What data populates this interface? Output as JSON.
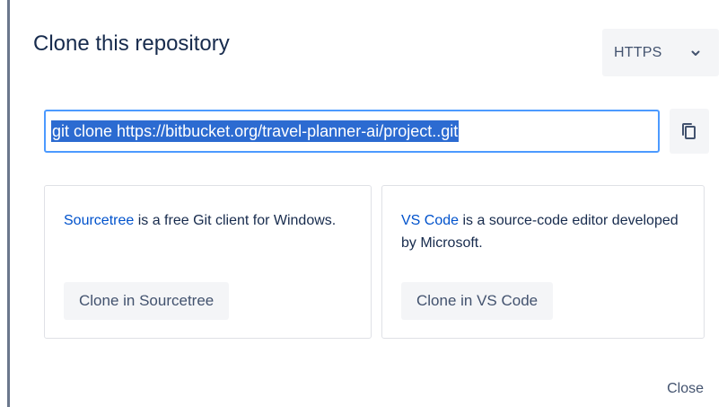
{
  "dialog": {
    "title": "Clone this repository",
    "protocol": {
      "selected": "HTTPS",
      "icon": "chevron-down-icon"
    },
    "clone_command": "git clone https://bitbucket.org/travel-planner-ai/project..git",
    "copy_icon": "copy-icon",
    "cards": [
      {
        "link_text": "Sourcetree",
        "description": " is a free Git client for Windows.",
        "button_label": "Clone in Sourcetree"
      },
      {
        "link_text": "VS Code",
        "description": " is a source-code editor developed by Microsoft.",
        "button_label": "Clone in VS Code"
      }
    ],
    "close_label": "Close"
  },
  "colors": {
    "link": "#0052cc",
    "selection": "#2c6bd1",
    "focus_border": "#4c9aff",
    "button_bg": "#f4f5f7",
    "title": "#172b4d"
  }
}
